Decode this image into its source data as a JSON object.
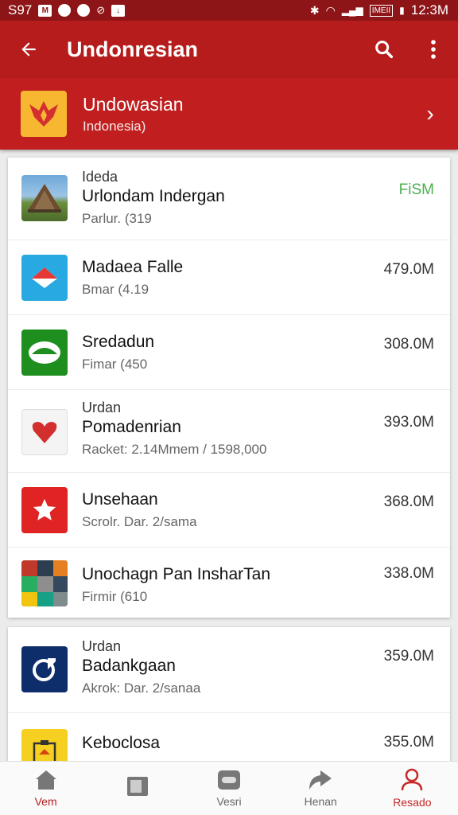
{
  "status": {
    "left_text": "S97",
    "time": "12:3M",
    "battery_text": "IMEII"
  },
  "toolbar": {
    "title": "Undonresian",
    "back_icon": "arrow-left-icon",
    "search_icon": "search-icon",
    "more_icon": "more-vert-icon"
  },
  "promo": {
    "name": "Undowasian",
    "subtitle": "Indonesia)"
  },
  "apps": [
    {
      "line1": "Ideda",
      "name": "Urlondam Indergan",
      "meta": "Parlur. (319",
      "size": "FiSM"
    },
    {
      "line1": "",
      "name": "Madaea Falle",
      "meta": "Bmar (4.19",
      "size": "479.0M"
    },
    {
      "line1": "",
      "name": "Sredadun",
      "meta": "Fimar (450",
      "size": "308.0M"
    },
    {
      "line1": "Urdan",
      "name": "Pomadenrian",
      "meta": "Racket: 2.14Mmem / 1598,000",
      "size": "393.0M"
    },
    {
      "line1": "",
      "name": "Unsehaan",
      "meta": "Scrolr. Dar. 2/sama",
      "size": "368.0M"
    },
    {
      "line1": "",
      "name": "Unochagn Pan InsharTan",
      "meta": "Firmir (610",
      "size": "338.0M"
    },
    {
      "line1": "Urdan",
      "name": "Badankgaan",
      "meta": "Akrok: Dar. 2/sanaa",
      "size": "359.0M"
    },
    {
      "line1": "",
      "name": "Keboclosa",
      "meta": "",
      "size": "355.0M"
    }
  ],
  "nav": [
    {
      "label": "Vem",
      "icon": "home-icon"
    },
    {
      "label": "",
      "icon": "library-icon"
    },
    {
      "label": "Vesri",
      "icon": "message-icon"
    },
    {
      "label": "Henan",
      "icon": "share-icon"
    },
    {
      "label": "Resado",
      "icon": "person-icon"
    }
  ],
  "colors": {
    "primary": "#b71c1c",
    "status_bar": "#8e1517",
    "accent_green": "#4caf50"
  }
}
